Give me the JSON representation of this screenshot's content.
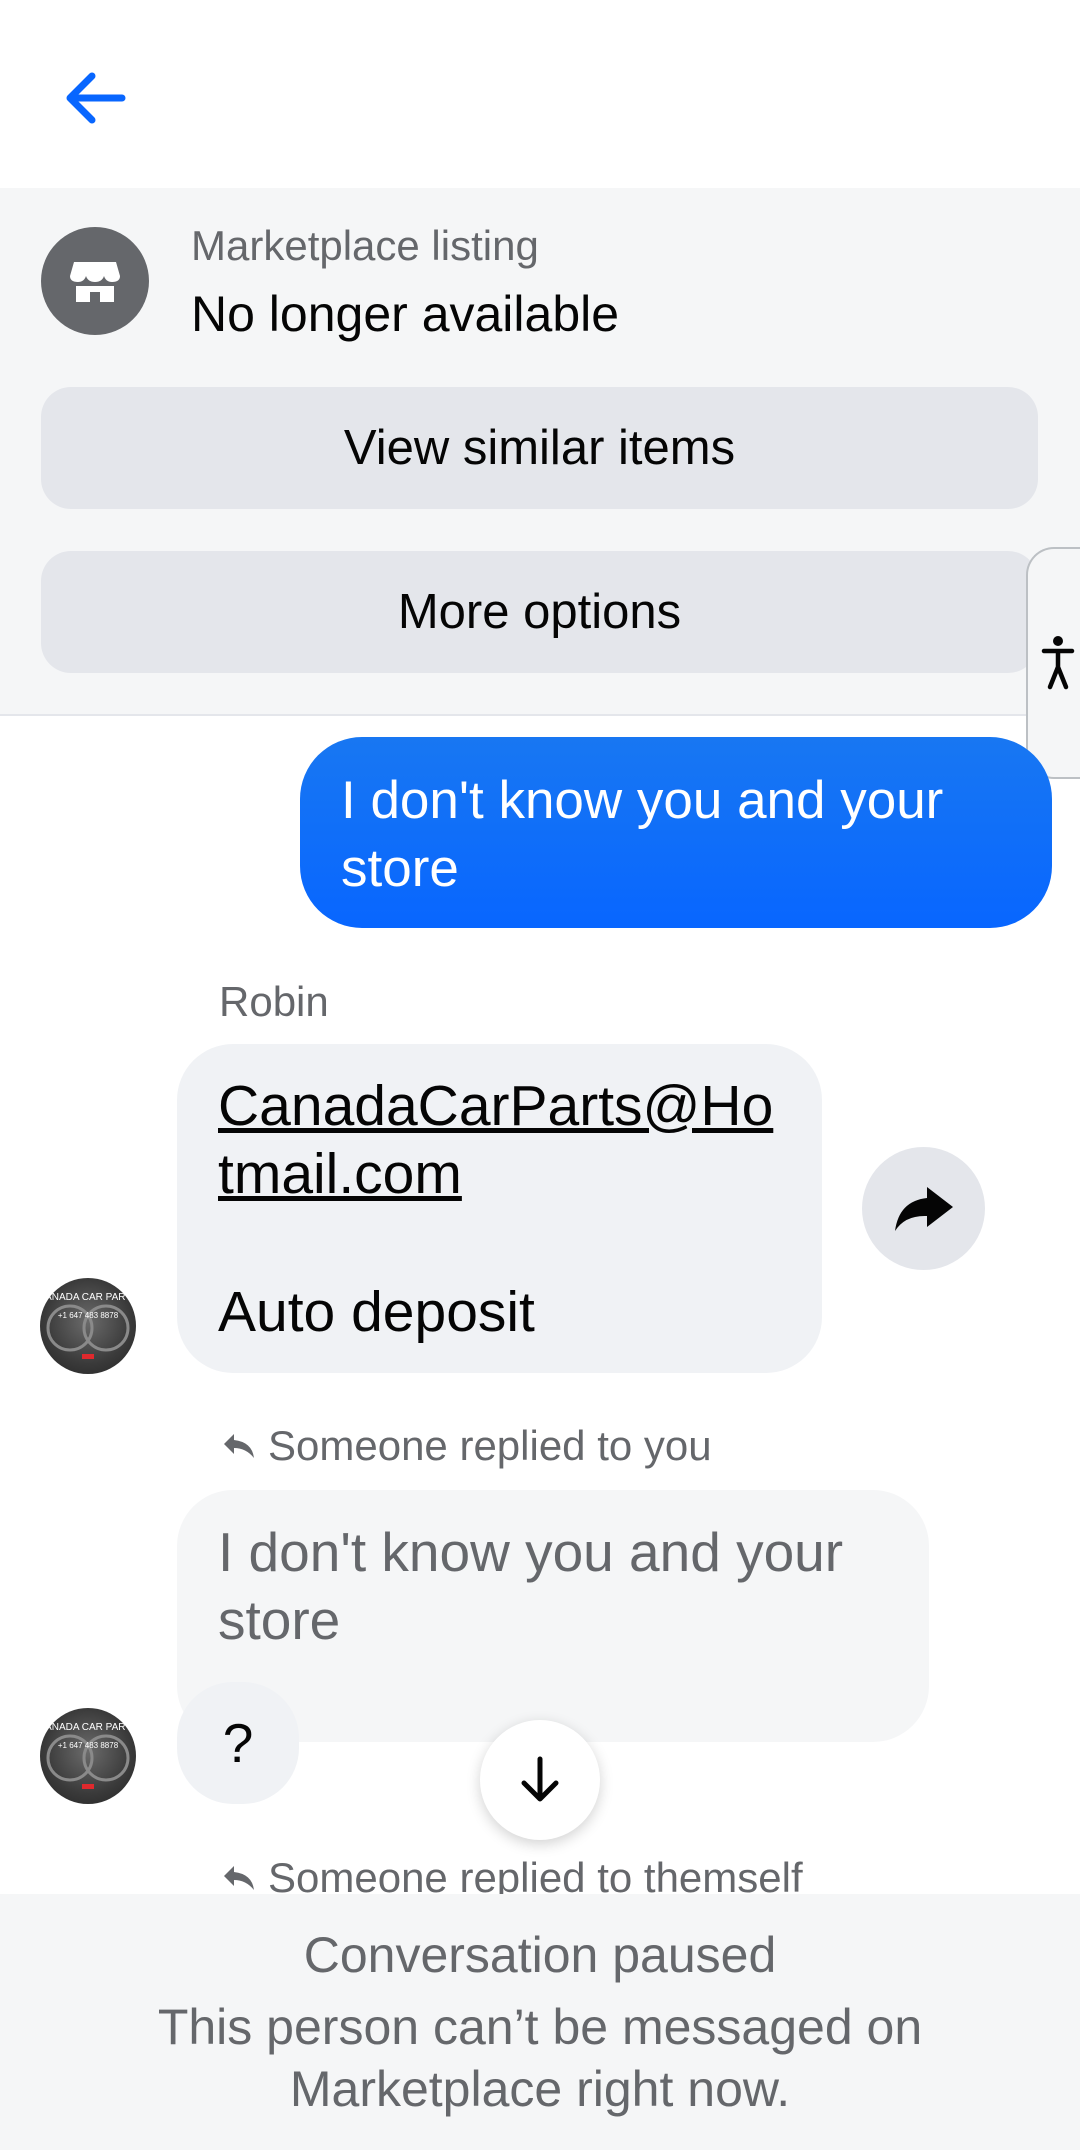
{
  "listing": {
    "label": "Marketplace listing",
    "status": "No longer available",
    "view_similar_label": "View similar items",
    "more_options_label": "More options"
  },
  "messages": {
    "outgoing_1": "I don't know you and your store",
    "sender_name": "Robin",
    "email": "CanadaCarParts@Hotmail.com",
    "email_note": "Auto deposit",
    "reply_note_1": "Someone replied to you",
    "quoted_text": "I don't know you and your store",
    "question": "?",
    "reply_note_2": "Someone replied to themself"
  },
  "avatar": {
    "line1": "CANADA CAR PARTS",
    "line2": "+1 647 483 8878"
  },
  "footer": {
    "title": "Conversation paused",
    "description": "This person can’t be messaged on Marketplace right now."
  },
  "colors": {
    "accent": "#0866ff",
    "bubble_in": "#f0f2f5",
    "panel": "#f5f6f7",
    "muted_text": "#65676b"
  },
  "icons": {
    "back": "arrow-left-icon",
    "store": "store-icon",
    "accessibility": "accessibility-icon",
    "forward": "share-forward-icon",
    "reply": "reply-arrow-icon",
    "scroll_down": "arrow-down-icon"
  }
}
